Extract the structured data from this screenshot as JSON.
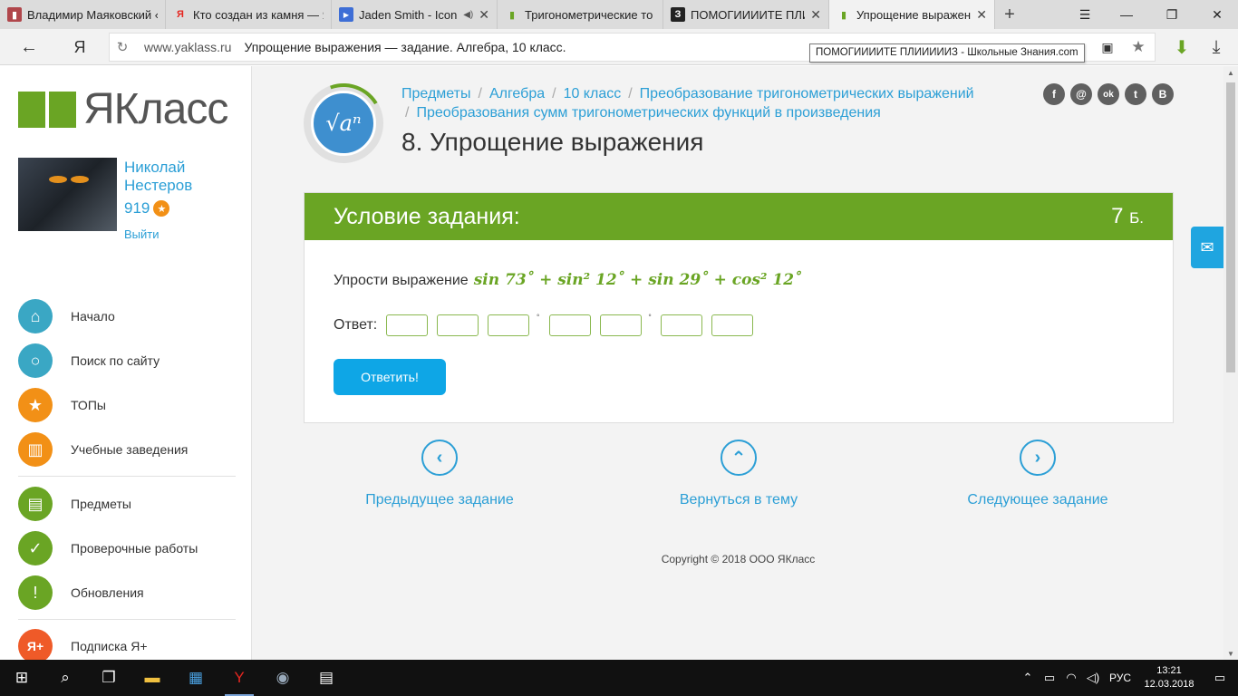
{
  "browser": {
    "tabs": [
      {
        "title": "Владимир Маяковский «",
        "favicon": "book-icon",
        "color": "#b0464b",
        "glyph": "▮"
      },
      {
        "title": "Кто создан из камня — Я",
        "favicon": "yandex-icon",
        "color": "#e52620",
        "glyph": "Я"
      },
      {
        "title": "Jaden Smith - Icon",
        "favicon": "play-icon",
        "color": "#3e6ed6",
        "glyph": "▶"
      },
      {
        "title": "Тригонометрические то",
        "favicon": "yaklass-icon",
        "color": "#6aa524",
        "glyph": "▮"
      },
      {
        "title": "ПОМОГИИИИТЕ ПЛИ",
        "favicon": "znanija-icon",
        "color": "#222222",
        "glyph": "З"
      },
      {
        "title": "Упрощение выражен",
        "favicon": "yaklass-icon",
        "color": "#6aa524",
        "glyph": "▮"
      }
    ],
    "back_glyph": "←",
    "yandex_logo": "Я",
    "url_domain": "www.yaklass.ru",
    "url_title": "Упрощение выражения — задание. Алгебра, 10 класс.",
    "tooltip": "ПОМОГИИИИТЕ ПЛИИИИИЗ - Школьные Знания.com"
  },
  "sidebar": {
    "logo_text": "ЯКласс",
    "user_first": "Николай",
    "user_last": "Нестеров",
    "score": "919",
    "logout": "Выйти",
    "menu": [
      {
        "label": "Начало",
        "icon": "home-icon",
        "color": "#3aa7c4",
        "glyph": "⌂"
      },
      {
        "label": "Поиск по сайту",
        "icon": "search-icon",
        "color": "#3aa7c4",
        "glyph": "○"
      },
      {
        "label": "ТОПы",
        "icon": "star-icon",
        "color": "#f29016",
        "glyph": "★"
      },
      {
        "label": "Учебные заведения",
        "icon": "building-icon",
        "color": "#f29016",
        "glyph": "▥"
      },
      {
        "label": "Предметы",
        "icon": "book-icon",
        "color": "#6aa524",
        "glyph": "▤"
      },
      {
        "label": "Проверочные работы",
        "icon": "check-icon",
        "color": "#6aa524",
        "glyph": "✓"
      },
      {
        "label": "Обновления",
        "icon": "exclamation-icon",
        "color": "#6aa524",
        "glyph": "!"
      },
      {
        "label": "Подписка Я+",
        "icon": "ya-plus-icon",
        "color": "#ef5a28",
        "glyph": "Я+"
      }
    ]
  },
  "breadcrumbs": {
    "items": [
      "Предметы",
      "Алгебра",
      "10 класс",
      "Преобразование тригонометрических выражений"
    ],
    "second_line": "Преобразования сумм тригонометрических функций в произведения",
    "separator": "/"
  },
  "page_title": "8. Упрощение выражения",
  "topic_badge": "√aⁿ",
  "social": [
    "f",
    "@",
    "ok",
    "t",
    "B"
  ],
  "task": {
    "header": "Условие задания:",
    "points": "7",
    "points_unit": "Б.",
    "question_label": "Упрости выражение",
    "expression": "sin 73˚ + sin² 12˚ + sin 29˚ + cos² 12˚",
    "answer_label": "Ответ:",
    "degree_mark": "˚",
    "submit_label": "Ответить!"
  },
  "navigation": {
    "prev": "Предыдущее задание",
    "up": "Вернуться в тему",
    "next": "Следующее задание"
  },
  "copyright": "Copyright © 2018 ООО ЯКласс",
  "taskbar": {
    "lang": "РУС",
    "time": "13:21",
    "date": "12.03.2018"
  }
}
